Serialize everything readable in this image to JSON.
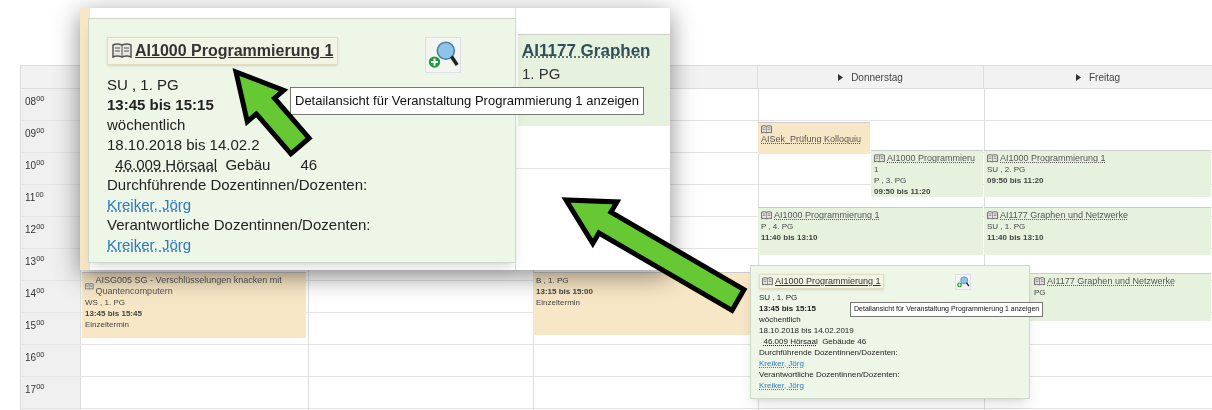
{
  "calendar": {
    "days": [
      {
        "label": "Donnerstag"
      },
      {
        "label": "Freitag"
      }
    ],
    "hours": [
      "08$^{00}$",
      "09$^{00}$",
      "10$^{00}$",
      "11$^{00}$",
      "12$^{00}$",
      "13$^{00}$",
      "14$^{00}$",
      "15$^{00}$",
      "16$^{00}$",
      "17$^{00}$"
    ],
    "events": [
      {
        "color": "#f8e7c6",
        "title": "AISG005 SG - Verschlüsselungen knacken mit Quantencomputern",
        "lines": [
          {
            "text": "WS , 1. PG",
            "kind": "info"
          },
          {
            "text": "13:45 bis 15:45",
            "kind": "time"
          },
          {
            "text": "Einzeltermin",
            "kind": "info"
          }
        ]
      },
      {
        "color": "#f8e7c6",
        "lines": [
          {
            "text": "B , 1. PG",
            "kind": "info"
          },
          {
            "text": "13:15 bis 15:00",
            "kind": "time"
          },
          {
            "text": "Einzeltermin",
            "kind": "info"
          }
        ]
      },
      {
        "color": "#f8e7c6",
        "title": "AISek_Prüfung Kolloquiu"
      },
      {
        "color": "#e6f2dd",
        "title": "AI1000 Programmieru",
        "lines": [
          {
            "text": "1",
            "kind": "info"
          },
          {
            "text": "P , 3. PG",
            "kind": "info"
          },
          {
            "text": "09:50 bis 11:20",
            "kind": "time"
          }
        ]
      },
      {
        "color": "#e6f2dd",
        "title": "AI1000 Programmierung 1",
        "lines": [
          {
            "text": "SU , 2. PG",
            "kind": "info"
          },
          {
            "text": "09:50 bis 11:20",
            "kind": "time"
          }
        ]
      },
      {
        "color": "#e6f2dd",
        "title": "AI1000 Programmierung 1",
        "lines": [
          {
            "text": "P , 4. PG",
            "kind": "info"
          },
          {
            "text": "11:40 bis 13:10",
            "kind": "time"
          }
        ]
      },
      {
        "color": "#e6f2dd",
        "title": "AI1177 Graphen und Netzwerke",
        "lines": [
          {
            "text": "SU , 1. PG",
            "kind": "info"
          },
          {
            "text": "11:40 bis 13:10",
            "kind": "time"
          }
        ]
      },
      {
        "color": "#e6f2dd",
        "title": "AI1177 Graphen und Netzwerke",
        "lines": [
          {
            "text": "PG",
            "kind": "info"
          }
        ]
      }
    ]
  },
  "zoomed_view": {
    "background_event": {
      "title": "AI1177 Graphen",
      "lines": [
        {
          "text": "1. PG",
          "kind": "info"
        }
      ]
    },
    "popup": {
      "title": "AI1000 Programmierung 1",
      "lines": [
        {
          "text": "SU , 1. PG",
          "kind": "info"
        },
        {
          "text": "13:45 bis 15:15",
          "kind": "time"
        },
        {
          "text": "wöchentlich",
          "kind": "info"
        },
        {
          "text": "18.10.2018 bis 14.02.2",
          "kind": "info"
        }
      ],
      "room": {
        "link": "46.009 Hörsaal",
        "texts": [
          "Gebäu",
          "46"
        ]
      },
      "sections": [
        {
          "heading": "Durchführende Dozentinnen/Dozenten:",
          "person": "Kreiker, Jörg"
        },
        {
          "heading": "Verantwortliche Dozentinnen/Dozenten:",
          "person": "Kreiker, Jörg"
        }
      ],
      "tooltip": "Detailansicht für Veranstaltung Programmierung 1 anzeigen"
    }
  },
  "popup": {
    "title": "AI1000 Programmierung 1",
    "lines": [
      {
        "text": "SU , 1. PG",
        "kind": "info"
      },
      {
        "text": "13:45 bis 15:15",
        "kind": "time"
      },
      {
        "text": "wöchentlich",
        "kind": "info"
      },
      {
        "text": "18.10.2018 bis 14.02.2019",
        "kind": "info"
      }
    ],
    "room": {
      "link": "46.009 Hörsaal",
      "texts": [
        "Gebäude 46"
      ]
    },
    "sections": [
      {
        "heading": "Durchführende Dozentinnen/Dozenten:",
        "person": "Kreiker, Jörg"
      },
      {
        "heading": "Verantwortliche Dozentinnen/Dozenten:",
        "person": "Kreiker, Jörg"
      }
    ],
    "tooltip": "Detailansicht für Veranstaltung Programmierung 1 anzeigen"
  }
}
